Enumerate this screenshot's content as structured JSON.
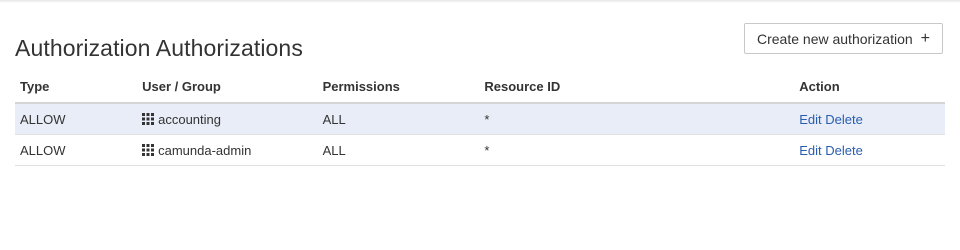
{
  "page": {
    "title": "Authorization Authorizations",
    "create_button_label": "Create new authorization",
    "create_button_icon": "plus-icon"
  },
  "table": {
    "headers": {
      "type": "Type",
      "user_group": "User / Group",
      "permissions": "Permissions",
      "resource_id": "Resource ID",
      "action": "Action"
    },
    "rows": [
      {
        "type": "ALLOW",
        "group_icon": "group-icon",
        "user_group": "accounting",
        "permissions": "ALL",
        "resource_id": "*",
        "edit": "Edit",
        "delete": "Delete"
      },
      {
        "type": "ALLOW",
        "group_icon": "group-icon",
        "user_group": "camunda-admin",
        "permissions": "ALL",
        "resource_id": "*",
        "edit": "Edit",
        "delete": "Delete"
      }
    ]
  },
  "colors": {
    "link": "#2a5db0",
    "row_highlight": "#e8edf7",
    "text": "#333333"
  }
}
